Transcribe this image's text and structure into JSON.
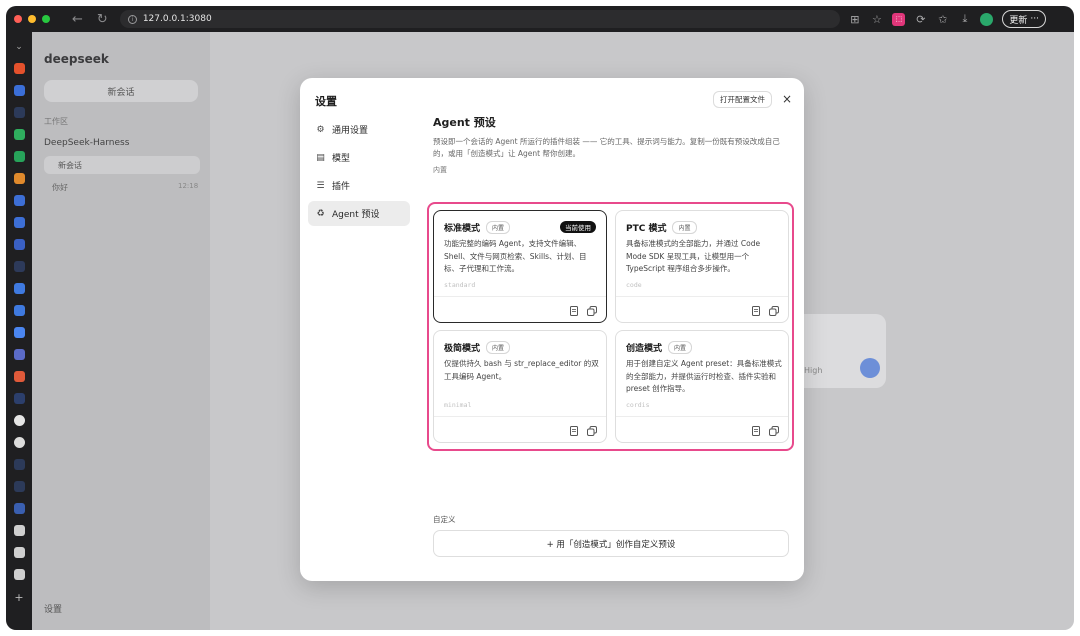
{
  "browser": {
    "url": "127.0.0.1:3080",
    "update_label": "更新",
    "more_label": "···"
  },
  "sidebar": {
    "brand": "deepseek",
    "new_chat": "新会话",
    "workspace_label": "工作区",
    "project": "DeepSeek-Harness",
    "active_chat": "新会话",
    "chat2": "你好",
    "chat2_time": "12:18",
    "settings": "设置"
  },
  "background": {
    "effort_label": "High"
  },
  "modal": {
    "title": "设置",
    "open_config": "打开配置文件",
    "close_icon": "×",
    "nav": [
      {
        "label": "通用设置",
        "icon": "gear-icon",
        "glyph": "⚙"
      },
      {
        "label": "模型",
        "icon": "database-icon",
        "glyph": "▤"
      },
      {
        "label": "插件",
        "icon": "sliders-icon",
        "glyph": "☰"
      },
      {
        "label": "Agent 预设",
        "icon": "recycle-icon",
        "glyph": "♻"
      }
    ],
    "selected_nav": 3
  },
  "content": {
    "title": "Agent 预设",
    "description": "预设即一个会话的 Agent 所运行的插件组装 —— 它的工具、提示词与能力。复制一份既有预设改成自己的，或用「创造模式」让 Agent 帮你创建。",
    "builtin_label": "内置",
    "custom_label": "自定义",
    "custom_button": "+ 用「创造模式」创作自定义预设",
    "cards": [
      {
        "name": "标准模式",
        "tag": "内置",
        "current": "当前使用",
        "desc": "功能完整的编码 Agent，支持文件编辑、Shell、文件与网页检索、Skills、计划、目标、子代理和工作流。",
        "id": "standard"
      },
      {
        "name": "PTC 模式",
        "tag": "内置",
        "current": "",
        "desc": "具备标准模式的全部能力，并通过 Code Mode SDK 呈现工具，让模型用一个 TypeScript 程序组合多步操作。",
        "id": "code"
      },
      {
        "name": "极简模式",
        "tag": "内置",
        "current": "",
        "desc": "仅提供持久 bash 与 str_replace_editor 的双工具编码 Agent。",
        "id": "minimal"
      },
      {
        "name": "创造模式",
        "tag": "内置",
        "current": "",
        "desc": "用于创建自定义 Agent preset：具备标准模式的全部能力，并提供运行时检查、插件实验和 preset 创作指导。",
        "id": "cordis"
      }
    ]
  },
  "colors": {
    "highlight": "#e84a8c",
    "current_badge": "#111111"
  }
}
